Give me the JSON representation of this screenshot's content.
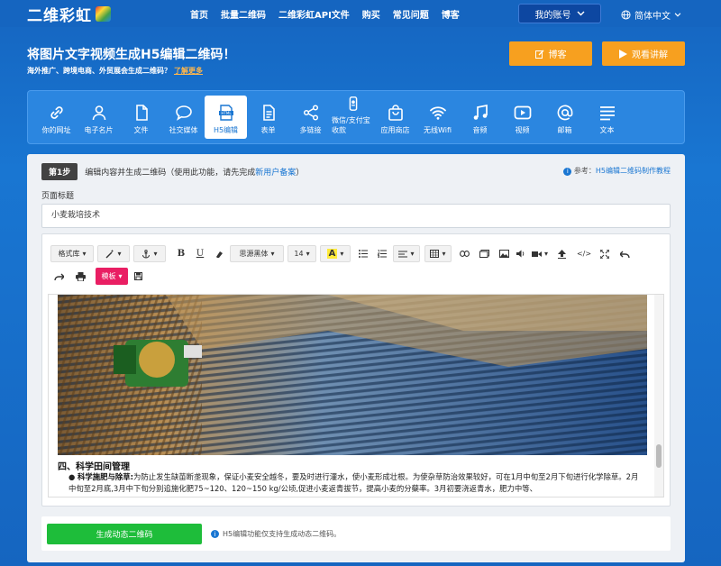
{
  "nav": {
    "logo": "二维彩虹",
    "links": [
      "首页",
      "批量二维码",
      "二维彩虹API文件",
      "购买",
      "常见问题",
      "博客"
    ],
    "account": "我的账号",
    "lang": "简体中文"
  },
  "hero": {
    "title": "将图片文字视频生成H5编辑二维码！",
    "subtitle": "海外推广、跨境电商、外贸展会生成二维码？",
    "learn_more": "了解更多",
    "blog_btn": "博客",
    "video_btn": "观看讲解"
  },
  "types": [
    {
      "label": "你的网址",
      "icon": "link-icon"
    },
    {
      "label": "电子名片",
      "icon": "person-icon"
    },
    {
      "label": "文件",
      "icon": "file-icon"
    },
    {
      "label": "社交媒体",
      "icon": "chat-icon"
    },
    {
      "label": "H5编辑",
      "icon": "html-icon"
    },
    {
      "label": "表单",
      "icon": "form-icon"
    },
    {
      "label": "多链接",
      "icon": "share-icon"
    },
    {
      "label": "微信/支付宝收款",
      "icon": "wallet-icon"
    },
    {
      "label": "应用商店",
      "icon": "bag-icon"
    },
    {
      "label": "无线Wifi",
      "icon": "wifi-icon"
    },
    {
      "label": "音频",
      "icon": "music-icon"
    },
    {
      "label": "视频",
      "icon": "video-icon"
    },
    {
      "label": "邮箱",
      "icon": "at-icon"
    },
    {
      "label": "文本",
      "icon": "text-icon"
    }
  ],
  "step": {
    "badge": "第1步",
    "text": "编辑内容并生成二维码（使用此功能，请先完成",
    "link": "新用户备案",
    "close": "）",
    "ref_label": "参考：",
    "ref_link": "H5编辑二维码制作教程"
  },
  "page_title_label": "页面标题",
  "page_title_value": "小麦栽培技术",
  "toolbar": {
    "format": "格式库",
    "font": "思源黑体",
    "size": "14",
    "template": "模板"
  },
  "content": {
    "heading": "四、科学田间管理",
    "bold_lead": "科学施肥与除草:",
    "paragraph": "为防止发生缺苗断垄现象，保证小麦安全越冬，要及时进行灌水，使小麦形成壮根。为使杂草防治效果较好，可在1月中旬至2月下旬进行化学除草。2月中旬至2月底,3月中下旬分别追施化肥75~120、120~150 kg/公顷,促进小麦返青拔节，提高小麦的分蘖率。3月初要浇返青水，肥力中等、"
  },
  "bottom": {
    "generate": "生成动态二维码",
    "note": "H5编辑功能仅支持生成动态二维码。"
  },
  "colors": {
    "brand": "#1976d2",
    "orange": "#f7a01f",
    "green": "#1ebd3a",
    "pink": "#e91e63"
  }
}
